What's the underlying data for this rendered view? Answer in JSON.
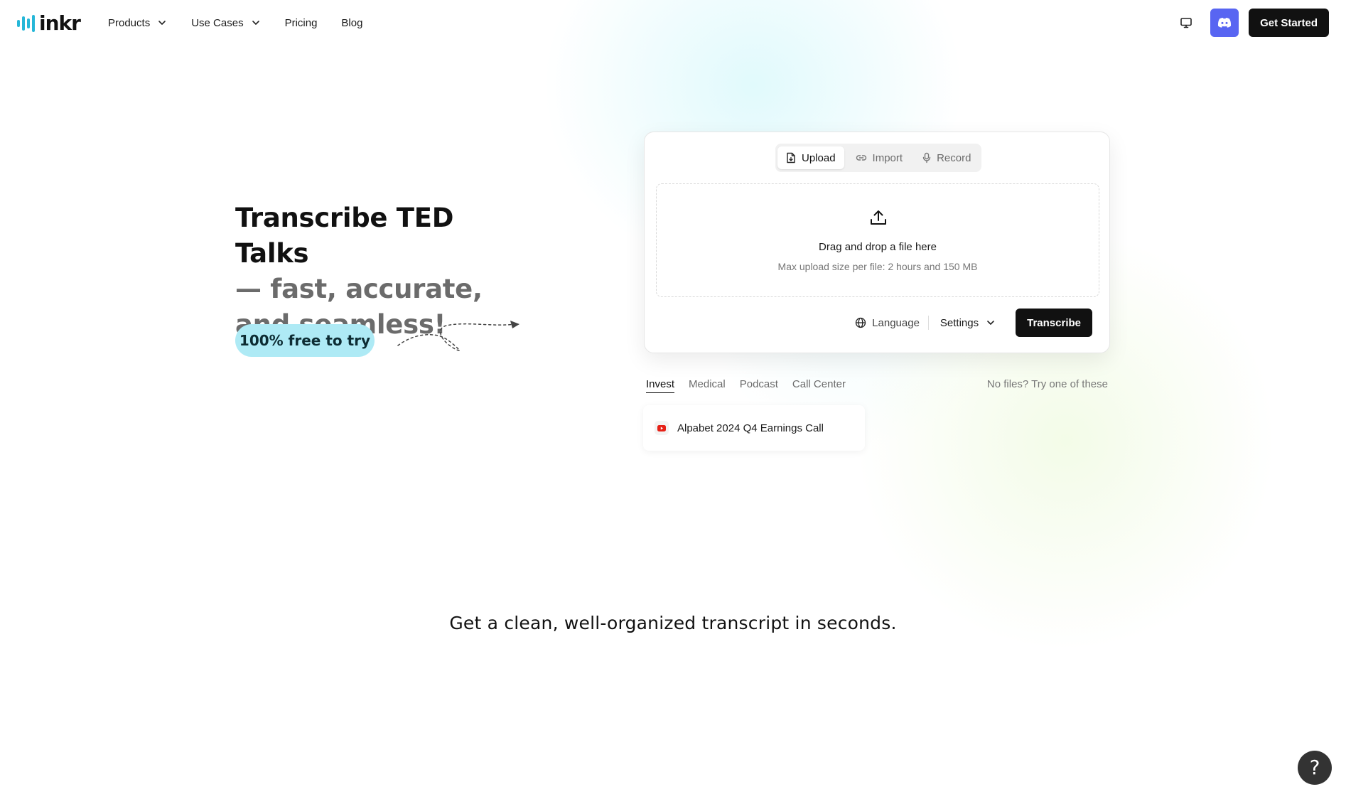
{
  "brand": {
    "name": "inkr",
    "accent": "#26b7d8"
  },
  "nav": {
    "links": [
      {
        "label": "Products",
        "has_dropdown": true
      },
      {
        "label": "Use Cases",
        "has_dropdown": true
      },
      {
        "label": "Pricing",
        "has_dropdown": false
      },
      {
        "label": "Blog",
        "has_dropdown": false
      }
    ],
    "desktop_icon": "monitor-icon",
    "discord_icon": "discord-icon",
    "cta_label": "Get Started"
  },
  "hero": {
    "title_line1": "Transcribe TED Talks",
    "title_line2": "— fast, accurate,",
    "title_line3": "and seamless!",
    "badge": "100% free to try"
  },
  "uploader": {
    "tabs": [
      {
        "label": "Upload",
        "icon": "file-icon",
        "active": true
      },
      {
        "label": "Import",
        "icon": "link-icon",
        "active": false
      },
      {
        "label": "Record",
        "icon": "mic-icon",
        "active": false
      }
    ],
    "drop_title": "Drag and drop a file here",
    "drop_subtitle": "Max upload size per file: 2 hours and 150 MB",
    "language_label": "Language",
    "settings_label": "Settings",
    "transcribe_label": "Transcribe"
  },
  "samples": {
    "categories": [
      "Invest",
      "Medical",
      "Podcast",
      "Call Center"
    ],
    "active_category": "Invest",
    "hint": "No files? Try one of these",
    "items": [
      {
        "label": "Alpabet 2024 Q4 Earnings Call",
        "icon": "youtube-icon"
      }
    ]
  },
  "subheadline": "Get a clean, well-organized transcript in seconds.",
  "help": {
    "label": "?"
  }
}
